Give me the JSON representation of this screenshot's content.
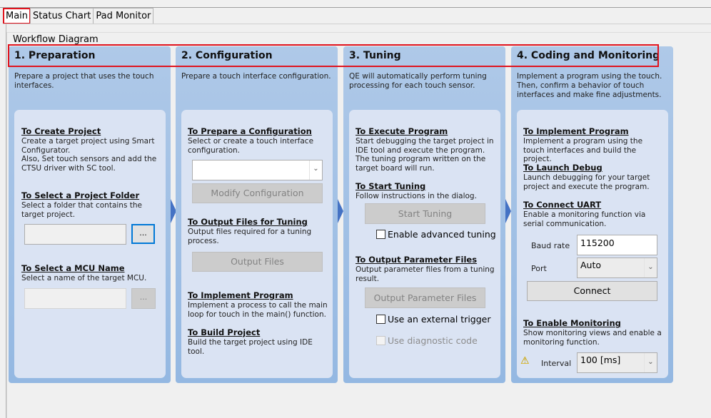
{
  "tabs": [
    {
      "label": "Main",
      "active": true
    },
    {
      "label": "Status Chart",
      "active": false
    },
    {
      "label": "Pad Monitor",
      "active": false
    }
  ],
  "group_title": "Workflow Diagram",
  "columns": [
    {
      "title": "1. Preparation",
      "description": "Prepare a project that uses the touch interfaces.",
      "sections": [
        {
          "title": "To Create Project",
          "desc": "Create a target project using Smart Configurator.\nAlso, Set touch sensors and add the CTSU driver with SC tool."
        },
        {
          "title": "To Select a Project Folder",
          "desc": "Select a folder that contains the target project."
        },
        {
          "title": "To Select a MCU Name",
          "desc": "Select a name of the target MCU."
        }
      ],
      "project_folder_value": "",
      "mcu_name_value": "",
      "browse_label": "..."
    },
    {
      "title": "2. Configuration",
      "description": "Prepare a touch interface configuration.",
      "sections": [
        {
          "title": "To Prepare a Configuration",
          "desc": "Select or create a touch interface configuration."
        },
        {
          "title": "To Output Files for Tuning",
          "desc": "Output files required for a tuning process."
        },
        {
          "title": "To Implement Program",
          "desc": "Implement a process to call the main loop for touch in the main() function."
        },
        {
          "title": "To Build Project",
          "desc": "Build the target project using IDE tool."
        }
      ],
      "config_select_value": "",
      "modify_button": "Modify Configuration",
      "output_button": "Output Files"
    },
    {
      "title": "3. Tuning",
      "description": "QE will automatically perform tuning processing for each touch sensor.",
      "sections": [
        {
          "title": "To Execute Program",
          "desc": "Start debugging the target project in IDE tool and execute the program. The tuning program written on the target board will run."
        },
        {
          "title": "To Start Tuning",
          "desc": "Follow instructions in the dialog."
        },
        {
          "title": "To Output Parameter Files",
          "desc": "Output parameter files from a tuning result."
        }
      ],
      "start_tuning_button": "Start Tuning",
      "advanced_tuning_label": "Enable advanced tuning",
      "advanced_tuning_checked": false,
      "output_param_button": "Output Parameter Files",
      "external_trigger_label": "Use an external trigger",
      "external_trigger_checked": false,
      "diagnostic_label": "Use diagnostic code",
      "diagnostic_checked": false
    },
    {
      "title": "4. Coding and Monitoring",
      "description": "Implement a program using the touch. Then, confirm a behavior of touch interfaces and make fine adjustments.",
      "sections": [
        {
          "title": "To Implement Program",
          "desc": "Implement a program using the touch interfaces and build the project."
        },
        {
          "title": "To Launch Debug",
          "desc": "Launch debugging for your target project and execute the program."
        },
        {
          "title": "To Connect UART",
          "desc": "Enable a monitoring function via serial communication."
        },
        {
          "title": "To Enable Monitoring",
          "desc": "Show monitoring views and enable a monitoring function."
        }
      ],
      "baud_label": "Baud rate",
      "baud_value": "115200",
      "port_label": "Port",
      "port_value": "Auto",
      "connect_button": "Connect",
      "interval_label": "Interval",
      "interval_value": "100 [ms]"
    }
  ],
  "icons": {
    "warning": "⚠",
    "chevron": "⌄"
  },
  "colors": {
    "highlight": "#e0141e",
    "arrow": "#4472c4",
    "focus": "#0078d7"
  }
}
